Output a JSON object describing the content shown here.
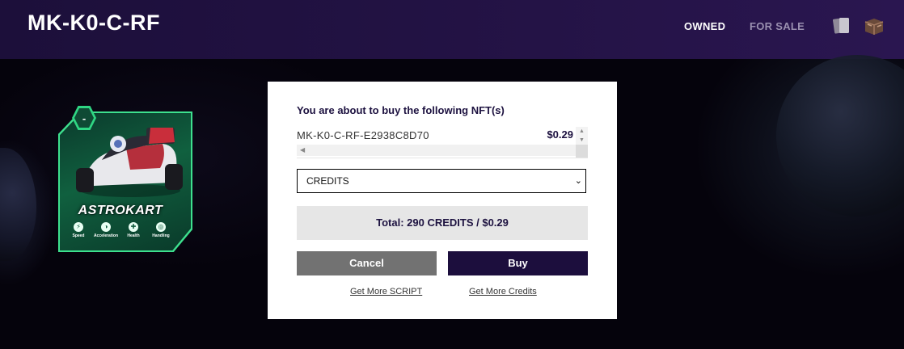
{
  "header": {
    "title": "MK-K0-C-RF",
    "nav": {
      "owned": "OWNED",
      "for_sale": "FOR SALE"
    },
    "icons": [
      "cards-icon",
      "crate-icon"
    ]
  },
  "card": {
    "badge": "-",
    "name": "ASTROKART",
    "stats": [
      {
        "label": "Speed"
      },
      {
        "label": "Acceleration"
      },
      {
        "label": "Health"
      },
      {
        "label": "Handling"
      }
    ],
    "accent_color": "#3de08e"
  },
  "dialog": {
    "heading": "You are about to buy the following NFT(s)",
    "items": [
      {
        "name": "MK-K0-C-RF-E2938C8D70",
        "price": "$0.29"
      }
    ],
    "currency_selected": "CREDITS",
    "total": "Total: 290 CREDITS / $0.29",
    "cancel_label": "Cancel",
    "buy_label": "Buy",
    "link_script": "Get More SCRIPT",
    "link_credits": "Get More Credits",
    "buy_color": "#1c0e3d",
    "cancel_color": "#727272"
  }
}
